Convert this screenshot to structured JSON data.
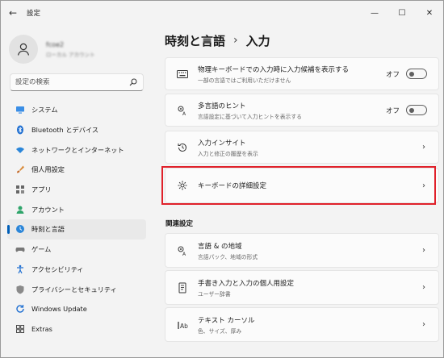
{
  "window": {
    "title": "設定",
    "back": "←",
    "minimize": "—",
    "maximize": "☐",
    "close": "✕"
  },
  "profile": {
    "name": "fcoe2",
    "sub": "ローカル アカウント"
  },
  "search": {
    "placeholder": "設定の検索"
  },
  "nav": [
    {
      "label": "システム",
      "icon": "monitor-icon"
    },
    {
      "label": "Bluetooth とデバイス",
      "icon": "bluetooth-icon"
    },
    {
      "label": "ネットワークとインターネット",
      "icon": "wifi-icon"
    },
    {
      "label": "個人用設定",
      "icon": "brush-icon"
    },
    {
      "label": "アプリ",
      "icon": "apps-icon"
    },
    {
      "label": "アカウント",
      "icon": "person-icon"
    },
    {
      "label": "時刻と言語",
      "icon": "globe-clock-icon",
      "active": true
    },
    {
      "label": "ゲーム",
      "icon": "gamepad-icon"
    },
    {
      "label": "アクセシビリティ",
      "icon": "accessibility-icon"
    },
    {
      "label": "プライバシーとセキュリティ",
      "icon": "shield-icon"
    },
    {
      "label": "Windows Update",
      "icon": "update-icon"
    },
    {
      "label": "Extras",
      "icon": "extras-icon"
    }
  ],
  "breadcrumb": {
    "parent": "時刻と言語",
    "sep": "›",
    "current": "入力"
  },
  "cards": {
    "hardware_keyboard": {
      "title": "物理キーボードでの入力時に入力候補を表示する",
      "sub": "一部の言語ではご利用いただけません",
      "toggle": "オフ"
    },
    "multilingual": {
      "title": "多言語のヒント",
      "sub": "言語設定に基づいて入力ヒントを表示する",
      "toggle": "オフ"
    },
    "typing_insights": {
      "title": "入力インサイト",
      "sub": "入力と修正の履歴を表示"
    },
    "keyboard_advanced": {
      "title": "キーボードの詳細設定"
    },
    "chevron": "›"
  },
  "related": {
    "label": "関連設定",
    "language_region": {
      "title": "言語 & の地域",
      "sub": "言語パック、地域の形式"
    },
    "handwriting": {
      "title": "手書き入力と入力の個人用設定",
      "sub": "ユーザー辞書"
    },
    "text_cursor": {
      "title": "テキスト カーソル",
      "sub": "色、サイズ、厚み"
    }
  },
  "colors": {
    "accent": "#005fb8",
    "highlight": "#e0202a"
  }
}
